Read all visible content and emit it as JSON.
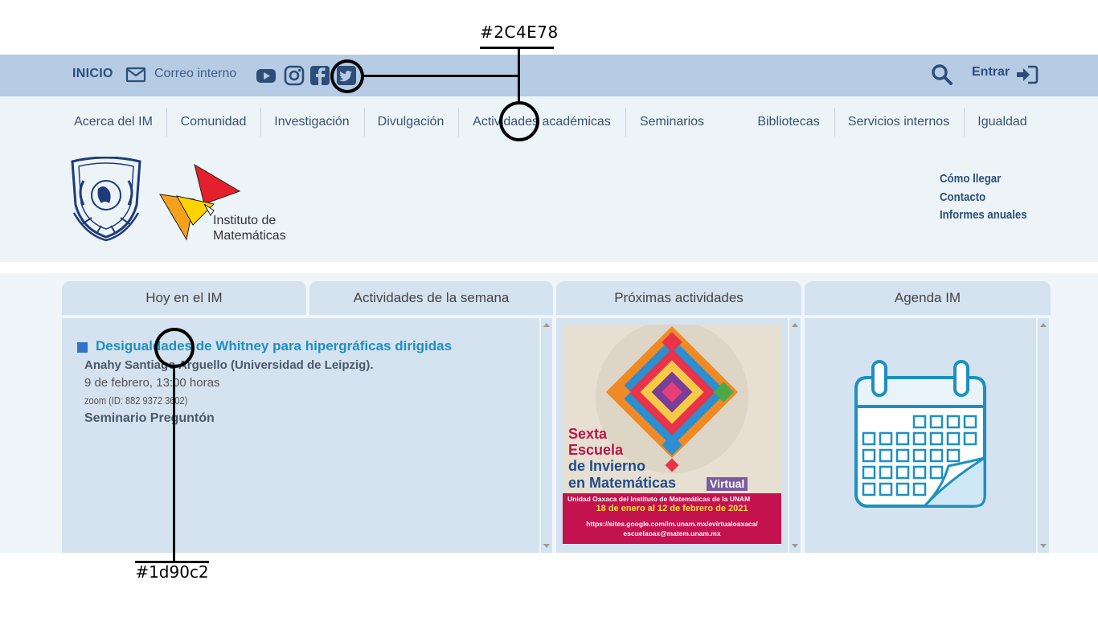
{
  "annotations": {
    "top_color": "#2C4E78",
    "bottom_color": "#1d90c2"
  },
  "header": {
    "inicio": "INICIO",
    "correo": "Correo interno",
    "entrar": "Entrar",
    "icons": [
      "mail-icon",
      "youtube-icon",
      "instagram-icon",
      "facebook-icon",
      "twitter-icon",
      "search-icon",
      "sign-in-icon"
    ]
  },
  "nav": {
    "items": [
      "Acerca del IM",
      "Comunidad",
      "Investigación",
      "Divulgación",
      "Actividades académicas",
      "Seminarios",
      "Bibliotecas",
      "Servicios internos",
      "Igualdad"
    ]
  },
  "logo": {
    "line1": "Instituto de",
    "line2": "Matemáticas"
  },
  "side_links": [
    "Cómo llegar",
    "Contacto",
    "Informes anuales"
  ],
  "tabs": [
    "Hoy en el IM",
    "Actividades de la semana",
    "Próximas actividades",
    "Agenda IM"
  ],
  "event": {
    "title": "Desigualdades de Whitney para hipergráficas dirigidas",
    "speaker": "Anahy Santiago Arguello (Universidad de Leipzig).",
    "date": "9 de febrero, 13:00 horas",
    "zoom": "zoom (ID: 882 9372 3602)",
    "series": "Seminario Preguntón"
  },
  "poster": {
    "line1": "Sexta",
    "line2": "Escuela",
    "line3": "de Invierno",
    "line4": "en Matemáticas",
    "virtual": "Virtual",
    "unit": "Unidad Oaxaca del Instituto de Matemáticas de la UNAM",
    "dates": "18 de enero al 12 de febrero de 2021",
    "url": "https://sites.google.com/im.unam.mx/evirtualoaxaca/",
    "email": "escuelaoax@matem.unam.mx"
  },
  "colors": {
    "header_bg": "#b6cbe4",
    "primary": "#2C4E78",
    "link": "#1d90c2",
    "panel_bg": "#d5e2ef"
  }
}
